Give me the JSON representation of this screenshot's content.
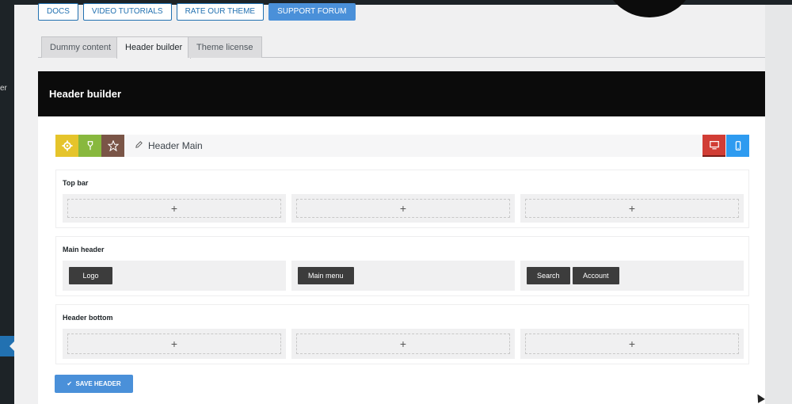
{
  "sidebar": {
    "fragment": "er"
  },
  "toplinks": [
    {
      "label": "DOCS"
    },
    {
      "label": "VIDEO TUTORIALS"
    },
    {
      "label": "RATE OUR THEME"
    },
    {
      "label": "SUPPORT FORUM"
    }
  ],
  "tabs": [
    {
      "label": "Dummy content"
    },
    {
      "label": "Header builder"
    },
    {
      "label": "Theme license"
    }
  ],
  "panel": {
    "title": "Header builder"
  },
  "builder": {
    "header_name": "Header Main",
    "icons": {
      "settings": "gear-icon",
      "hanger": "hanger-icon",
      "favorite": "star-icon",
      "desktop": "desktop-icon",
      "mobile": "mobile-icon",
      "edit": "pencil-icon"
    }
  },
  "rows": [
    {
      "label": "Top bar",
      "columns": [
        {
          "add": "+"
        },
        {
          "add": "+"
        },
        {
          "add": "+"
        }
      ]
    },
    {
      "label": "Main header",
      "columns": [
        {
          "elements": [
            "Logo"
          ]
        },
        {
          "elements": [
            "Main menu"
          ]
        },
        {
          "elements": [
            "Search",
            "Account"
          ]
        }
      ]
    },
    {
      "label": "Header bottom",
      "columns": [
        {
          "add": "+"
        },
        {
          "add": "+"
        },
        {
          "add": "+"
        }
      ]
    }
  ],
  "save_button": {
    "label": "SAVE HEADER",
    "icon": "check-icon"
  },
  "colors": {
    "accent": "#4a90d9",
    "dark": "#0b0b0b",
    "yellow": "#e5c42b",
    "green": "#88b83e",
    "brown": "#7a5547",
    "red": "#d13d35",
    "blue": "#2e9bf0"
  }
}
